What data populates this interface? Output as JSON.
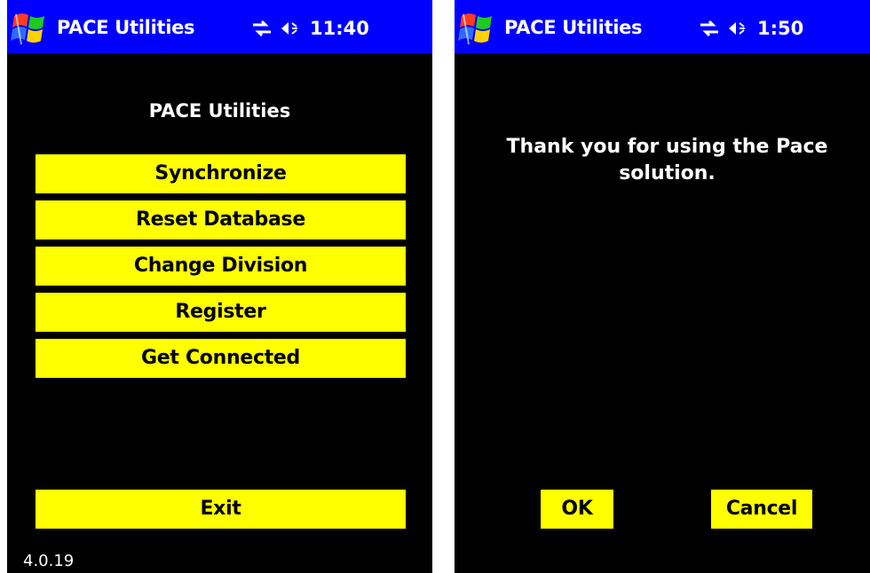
{
  "left_screen": {
    "titlebar": {
      "title": "PACE Utilities",
      "time": "11:40",
      "icons": [
        "windows-start-icon",
        "connectivity-icon",
        "volume-icon"
      ]
    },
    "heading": "PACE Utilities",
    "menu": [
      {
        "label": "Synchronize"
      },
      {
        "label": "Reset Database"
      },
      {
        "label": "Change Division"
      },
      {
        "label": "Register"
      },
      {
        "label": "Get Connected"
      }
    ],
    "exit_label": "Exit",
    "version": "4.0.19"
  },
  "right_screen": {
    "titlebar": {
      "title": "PACE Utilities",
      "time": "1:50",
      "icons": [
        "windows-start-icon",
        "connectivity-icon",
        "volume-icon"
      ]
    },
    "message": "Thank you for using the Pace solution.",
    "ok_label": "OK",
    "cancel_label": "Cancel"
  },
  "colors": {
    "titlebar": "#0000ff",
    "background": "#000000",
    "button": "#ffff00",
    "button_text": "#000000",
    "text": "#ffffff"
  }
}
